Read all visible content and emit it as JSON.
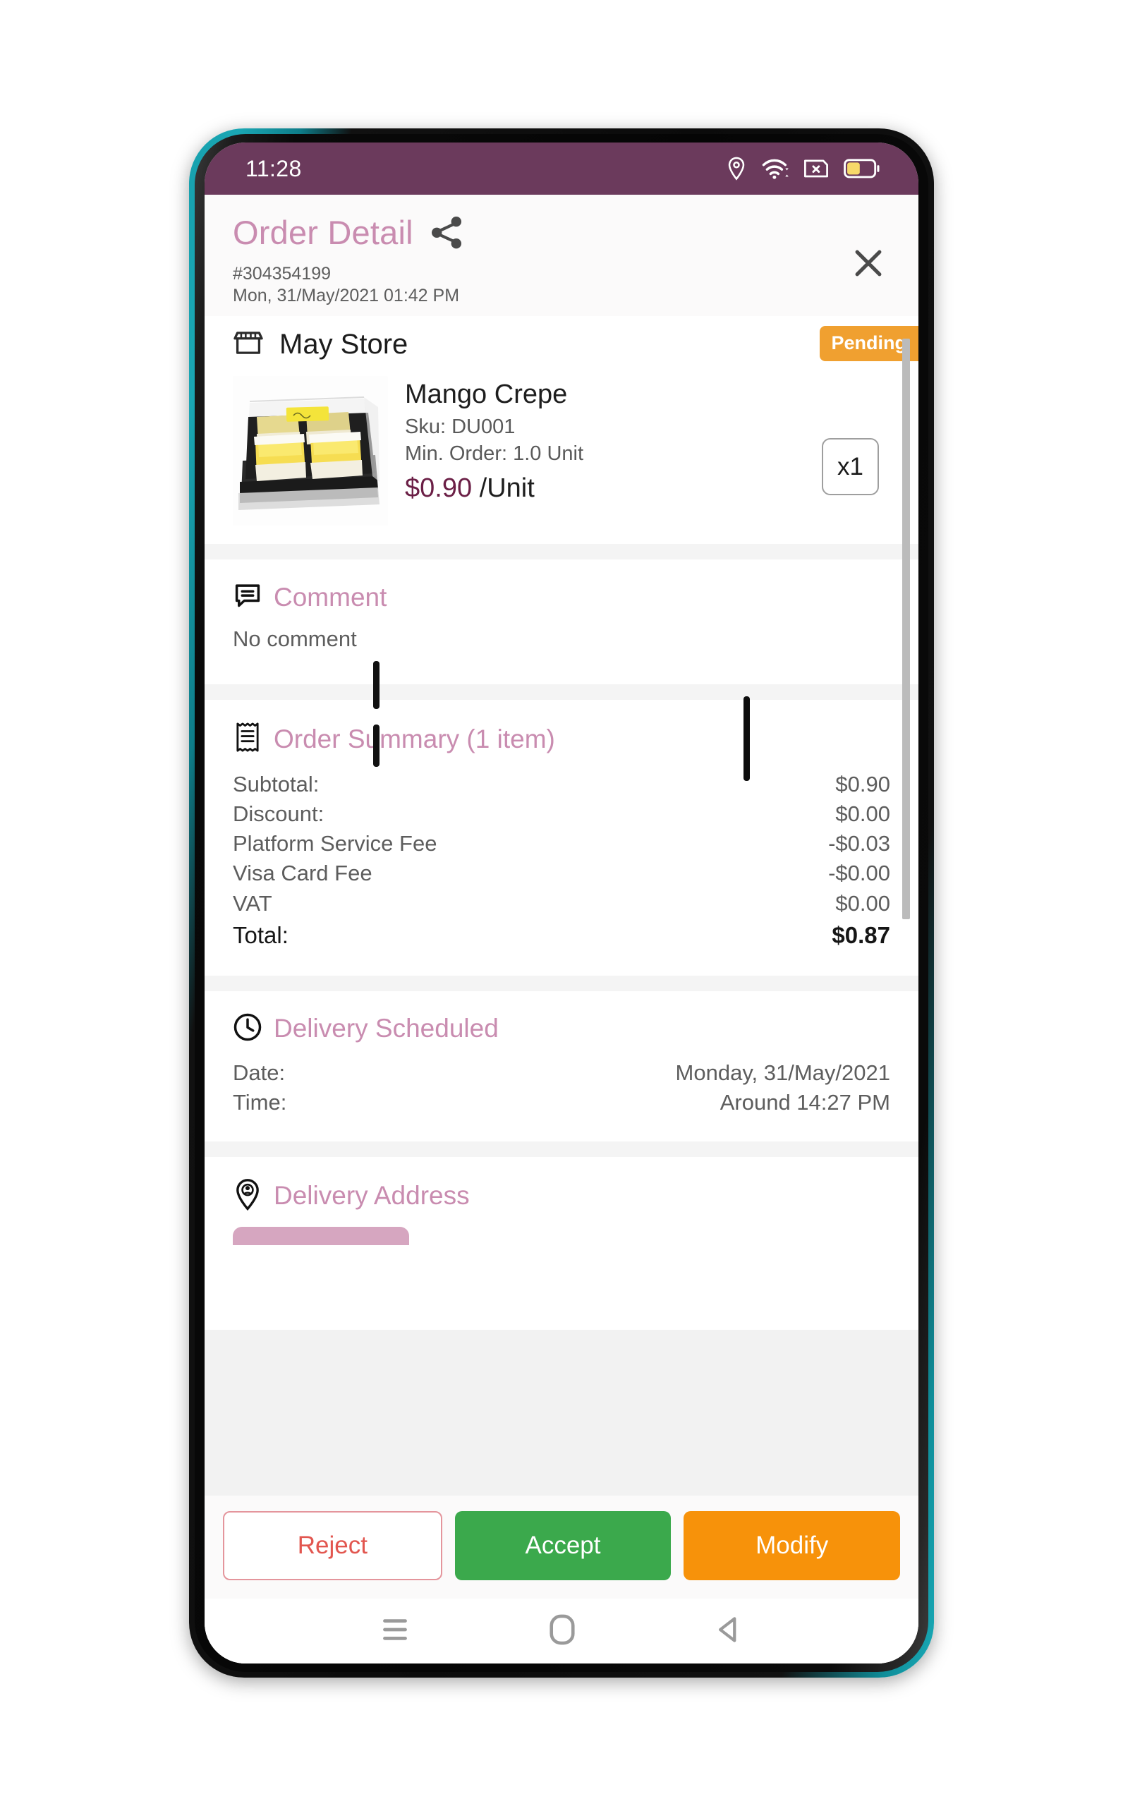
{
  "status_bar": {
    "time": "11:28",
    "icons": [
      "location-pin-icon",
      "wifi-icon",
      "sim-card-off-icon",
      "battery-icon"
    ],
    "background_color": "#6b3a5c"
  },
  "header": {
    "title": "Order Detail",
    "share_icon": "share-icon",
    "close_icon": "close-icon",
    "order_number": "#304354199",
    "order_datetime": "Mon, 31/May/2021 01:42 PM",
    "title_color": "#c98cb0"
  },
  "store": {
    "icon": "store-icon",
    "name": "May Store",
    "status_badge": "Pending",
    "badge_color": "#f0a030"
  },
  "product": {
    "image_alt": "mango-crepe-cakes-in-black-tray",
    "name": "Mango Crepe",
    "sku": "Sku: DU001",
    "min_order": "Min. Order: 1.0 Unit",
    "price": "$0.90",
    "price_unit": " /Unit",
    "quantity": "x1",
    "price_color": "#6b1f46"
  },
  "comment": {
    "icon": "comment-icon",
    "title": "Comment",
    "body": "No comment"
  },
  "order_summary": {
    "icon": "receipt-icon",
    "title": "Order Summary (1 item)",
    "lines": [
      {
        "label": "Subtotal:",
        "value": "$0.90"
      },
      {
        "label": "Discount:",
        "value": "$0.00"
      },
      {
        "label": "Platform Service Fee",
        "value": "-$0.03"
      },
      {
        "label": "Visa Card Fee",
        "value": "-$0.00"
      },
      {
        "label": "VAT",
        "value": "$0.00"
      }
    ],
    "total": {
      "label": "Total:",
      "value": "$0.87"
    }
  },
  "delivery_scheduled": {
    "icon": "clock-icon",
    "title": "Delivery Scheduled",
    "date_label": "Date:",
    "date_value": "Monday, 31/May/2021",
    "time_label": "Time:",
    "time_value": "Around 14:27 PM"
  },
  "delivery_address": {
    "icon": "location-pin-icon",
    "title": "Delivery Address"
  },
  "actions": {
    "reject": "Reject",
    "accept": "Accept",
    "modify": "Modify",
    "reject_color": "#e2564f",
    "accept_color": "#3ba94c",
    "modify_color": "#f7920a"
  },
  "android_nav": {
    "recents_icon": "menu-icon",
    "home_icon": "home-icon",
    "back_icon": "back-icon"
  }
}
